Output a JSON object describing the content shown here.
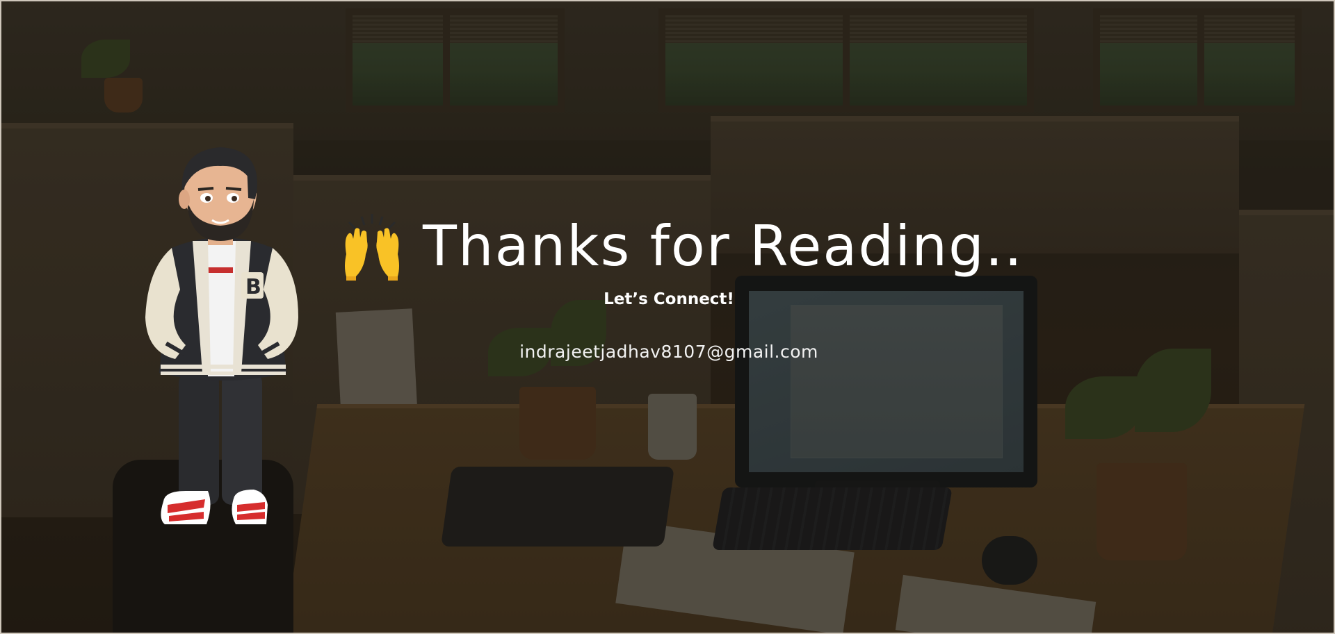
{
  "slide": {
    "title": "Thanks for Reading..",
    "subtitle": "Let’s Connect!",
    "email": "indrajeetjadhav8107@gmail.com",
    "title_icon": "raising-hands-icon",
    "colors": {
      "text": "#ffffff",
      "background_tint": "#2f291f",
      "border": "#cfc7bb"
    }
  }
}
